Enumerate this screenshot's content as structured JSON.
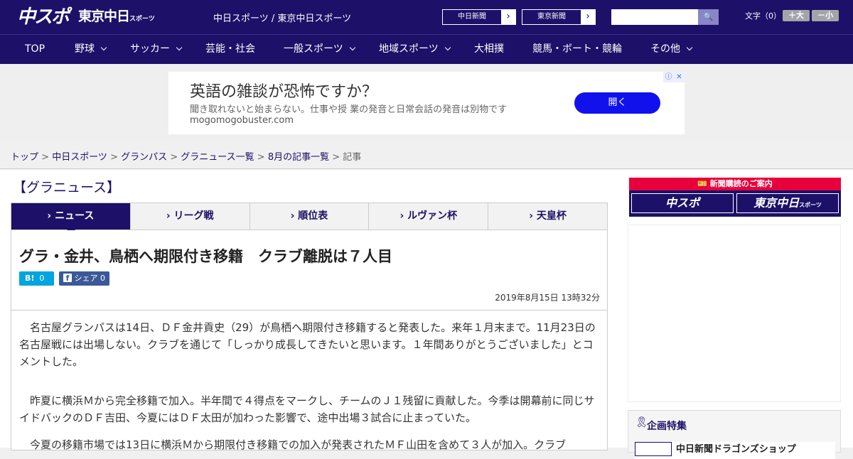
{
  "header": {
    "logo_chuspo": "中スポ",
    "logo_tokyo": "東京中日",
    "logo_tokyo_small": "スポーツ",
    "site_title": "中日スポーツ / 東京中日スポーツ",
    "paper_links": [
      "中日新聞",
      "東京新聞"
    ],
    "search_icon": "🔍",
    "font_size_label": "文字（0）",
    "font_larger": "＋大",
    "font_smaller": "－小"
  },
  "nav": {
    "items": [
      {
        "label": "TOP",
        "dropdown": false
      },
      {
        "label": "野球",
        "dropdown": true
      },
      {
        "label": "サッカー",
        "dropdown": true
      },
      {
        "label": "芸能・社会",
        "dropdown": false
      },
      {
        "label": "一般スポーツ",
        "dropdown": true
      },
      {
        "label": "地域スポーツ",
        "dropdown": true
      },
      {
        "label": "大相撲",
        "dropdown": false
      },
      {
        "label": "競馬・ボート・競輪",
        "dropdown": false
      },
      {
        "label": "その他",
        "dropdown": true
      }
    ]
  },
  "ad": {
    "headline": "英語の雑談が恐怖ですか？",
    "description": "聞き取れないと始まらない。仕事や授 業の発音と日常会話の発音は別物です",
    "url": "mogomogobuster.com",
    "open_button": "開く",
    "info_icon": "ⓘ",
    "close_icon": "✕"
  },
  "breadcrumb": {
    "links": [
      "トップ",
      "中日スポーツ",
      "グランパス",
      "グラニュース一覧",
      "8月の記事一覧"
    ],
    "separator": " > ",
    "current": "記事"
  },
  "section_title": "【グラニュース】",
  "tabs": [
    {
      "label": "› ニュース",
      "active": true
    },
    {
      "label": "› リーグ戦",
      "active": false
    },
    {
      "label": "› 順位表",
      "active": false
    },
    {
      "label": "› ルヴァン杯",
      "active": false
    },
    {
      "label": "› 天皇杯",
      "active": false
    }
  ],
  "article": {
    "headline": "グラ・金井、鳥栖へ期限付き移籍　クラブ離脱は７人目",
    "hatena": {
      "label": "B!",
      "count": "0"
    },
    "facebook": {
      "label": "シェア",
      "count": "0"
    },
    "datetime": "2019年8月15日 13時32分",
    "paragraphs": [
      "　名古屋グランパスは14日、ＤＦ金井貢史（29）が鳥栖へ期限付き移籍すると発表した。来年１月末まで。11月23日の名古屋戦には出場しない。クラブを通じて「しっかり成長してきたいと思います。１年間ありがとうございました」とコメントした。",
      "　昨夏に横浜Ｍから完全移籍で加入。半年間で４得点をマークし、チームのＪ１残留に貢献した。今季は開幕前に同じサイドバックのＤＦ吉田、今夏にはＤＦ太田が加わった影響で、途中出場３試合に止まっていた。",
      "　今夏の移籍市場では13日に横浜Ｍから期限付き移籍での加入が発表されたＭＦ山田を含めて３人が加入。クラブ"
    ]
  },
  "sidebar": {
    "subscription_label": "新聞購読のご案内",
    "subscription_buttons": [
      "中スポ",
      "東京中日"
    ],
    "subscription_small": "スポーツ",
    "feature_title": "企画特集",
    "feature_item": "中日新聞ドラゴンズショップ"
  },
  "colors": {
    "brand_navy": "#1c1068",
    "ad_button": "#1111ee",
    "sub_red": "#e8003c",
    "hatena": "#00a4de",
    "facebook": "#3b5998"
  }
}
